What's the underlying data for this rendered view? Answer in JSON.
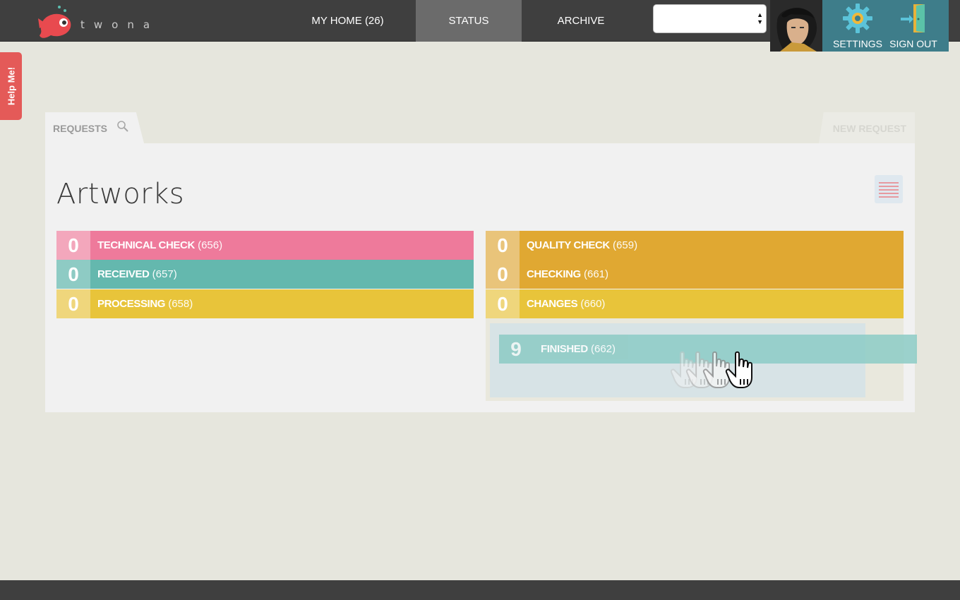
{
  "brand": {
    "name": "twona"
  },
  "nav": {
    "items": [
      {
        "label": "MY HOME (26)"
      },
      {
        "label": "STATUS"
      },
      {
        "label": "ARCHIVE"
      }
    ],
    "active": "STATUS"
  },
  "toolbar": {
    "settings_label": "SETTINGS",
    "signout_label": "SIGN OUT"
  },
  "help_tab": {
    "label": "Help Me!"
  },
  "tabs": {
    "requests_label": "REQUESTS",
    "new_request_label": "NEW REQUEST"
  },
  "page": {
    "title": "Artworks"
  },
  "statuses_left": [
    {
      "count": "0",
      "name": "TECHNICAL CHECK",
      "id": "(656)",
      "color": "#ee7a9b",
      "count_color": "#f3a7bc"
    },
    {
      "count": "0",
      "name": "RECEIVED",
      "id": "(657)",
      "color": "#64b8ae",
      "count_color": "#8ecbc4"
    },
    {
      "count": "0",
      "name": "PROCESSING",
      "id": "(658)",
      "color": "#e8c43a",
      "count_color": "#efd67c"
    }
  ],
  "statuses_right": [
    {
      "count": "0",
      "name": "QUALITY CHECK",
      "id": "(659)",
      "color": "#e0a832",
      "count_color": "#e9c47a"
    },
    {
      "count": "0",
      "name": "CHECKING",
      "id": "(661)",
      "color": "#e0a832",
      "count_color": "#e9c47a"
    },
    {
      "count": "0",
      "name": "CHANGES",
      "id": "(660)",
      "color": "#e8c43a",
      "count_color": "#efd67c"
    }
  ],
  "dragging_status": {
    "count": "9",
    "name": "FINISHED",
    "id": "(662)",
    "color": "#8ccbc5"
  },
  "colors": {
    "topbar": "#3f3f3f",
    "active_nav": "#6b6b6b",
    "accent_teal": "#3e7d8a",
    "help_red": "#e45a58"
  }
}
